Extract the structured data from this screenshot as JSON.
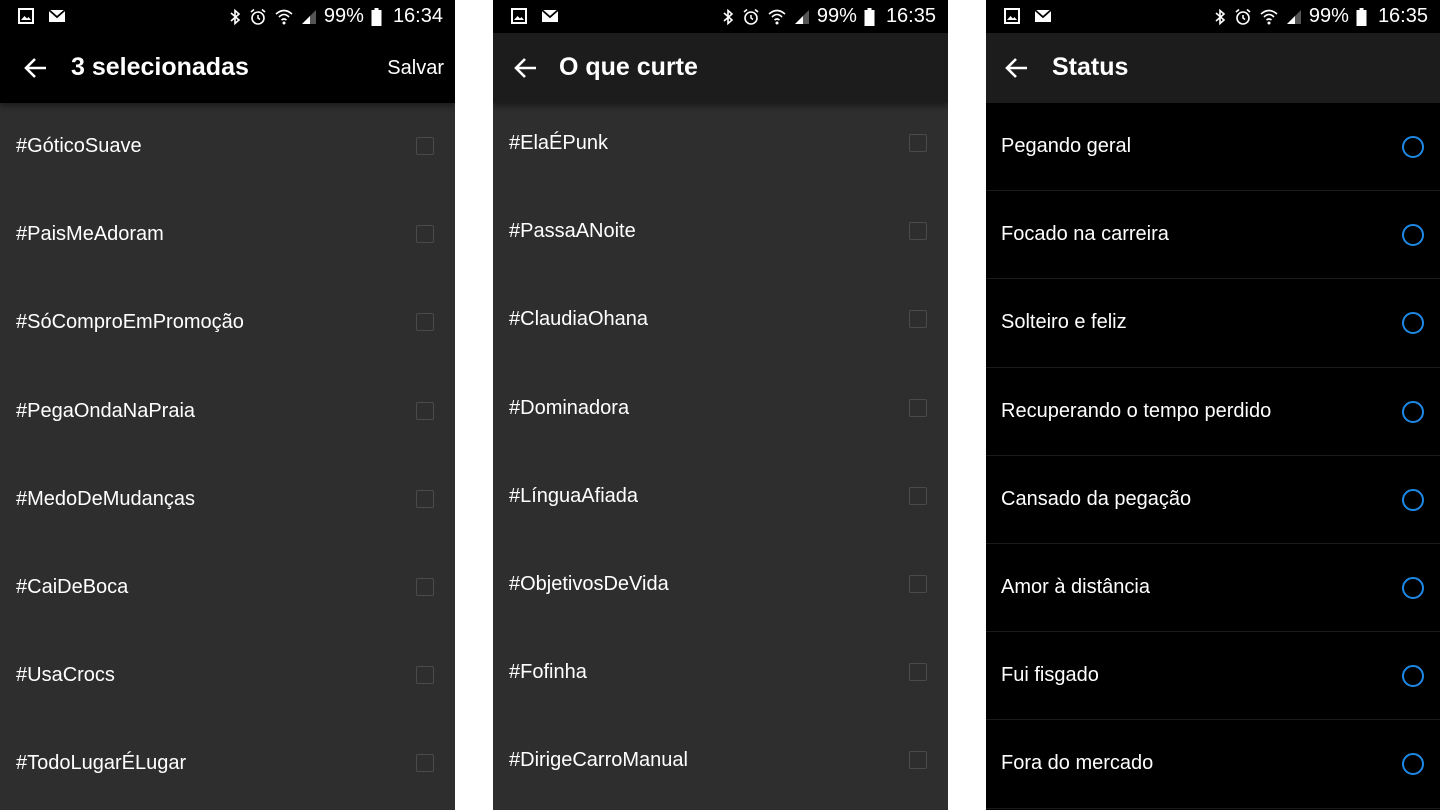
{
  "screens": [
    {
      "status": {
        "battery": "99%",
        "time": "16:34"
      },
      "toolbar": {
        "title": "3 selecionadas",
        "action": "Salvar"
      },
      "items": [
        "#GóticoSuave",
        "#PaisMeAdoram",
        "#SóComproEmPromoção",
        "#PegaOndaNaPraia",
        "#MedoDeMudanças",
        "#CaiDeBoca",
        "#UsaCrocs",
        "#TodoLugarÉLugar"
      ]
    },
    {
      "status": {
        "battery": "99%",
        "time": "16:35"
      },
      "toolbar": {
        "title": "O que curte"
      },
      "items": [
        "#ElaÉPunk",
        "#PassaANoite",
        "#ClaudiaOhana",
        "#Dominadora",
        "#LínguaAfiada",
        "#ObjetivosDeVida",
        "#Fofinha",
        "#DirigeCarroManual"
      ]
    },
    {
      "status": {
        "battery": "99%",
        "time": "16:35"
      },
      "toolbar": {
        "title": "Status"
      },
      "items": [
        "Pegando geral",
        "Focado na carreira",
        "Solteiro e feliz",
        "Recuperando o tempo perdido",
        "Cansado da pegação",
        "Amor à distância",
        "Fui fisgado",
        "Fora do mercado"
      ]
    }
  ],
  "colors": {
    "statusbar": "#000000",
    "list_background": "#2e2e2e",
    "status_list_background": "#000000",
    "radio_accent": "#1e88e5",
    "text": "#ffffff"
  }
}
